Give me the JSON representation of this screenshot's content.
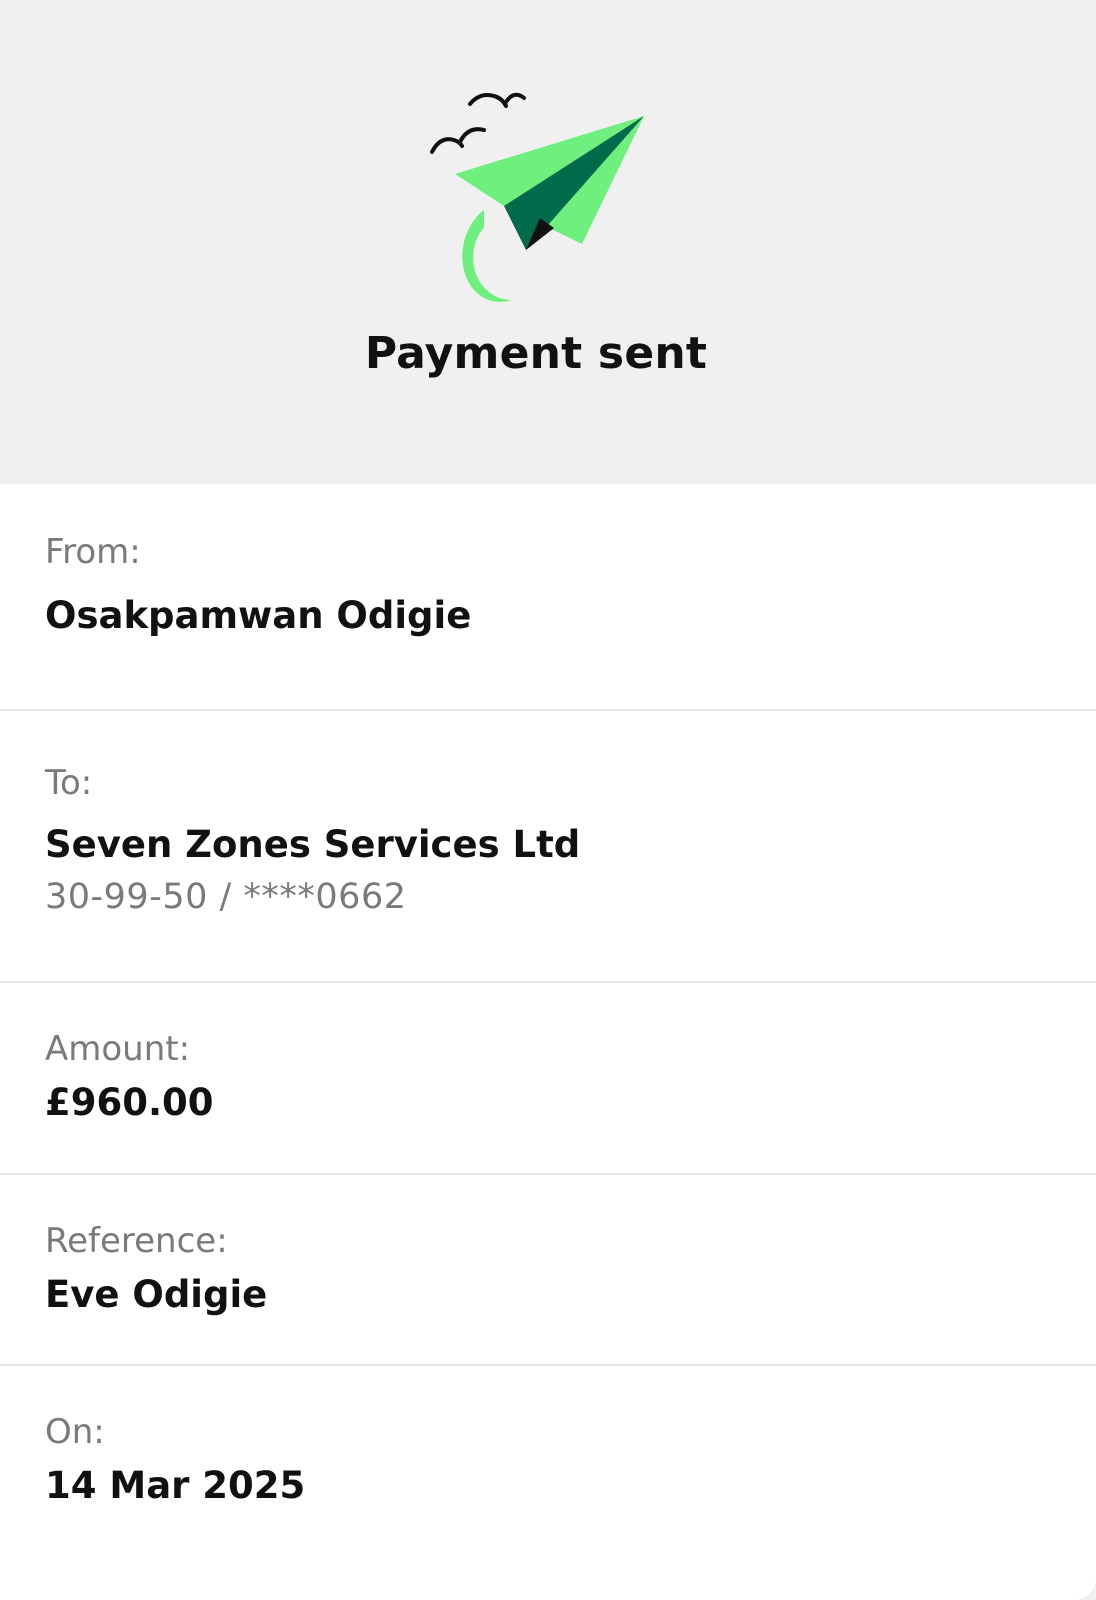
{
  "header": {
    "title": "Payment sent",
    "illustration": "paper-plane-with-birds-icon"
  },
  "details": {
    "from": {
      "label": "From:",
      "value": "Osakpamwan Odigie"
    },
    "to": {
      "label": "To:",
      "value": "Seven Zones Services Ltd",
      "account": "30-99-50 / ****0662"
    },
    "amount": {
      "label": "Amount:",
      "value": "£960.00"
    },
    "reference": {
      "label": "Reference:",
      "value": "Eve Odigie"
    },
    "date": {
      "label": "On:",
      "value": "14 Mar 2025"
    }
  },
  "colors": {
    "plane_light": "#6ff07e",
    "plane_dark": "#006b4b",
    "background": "#f0f0f0"
  }
}
